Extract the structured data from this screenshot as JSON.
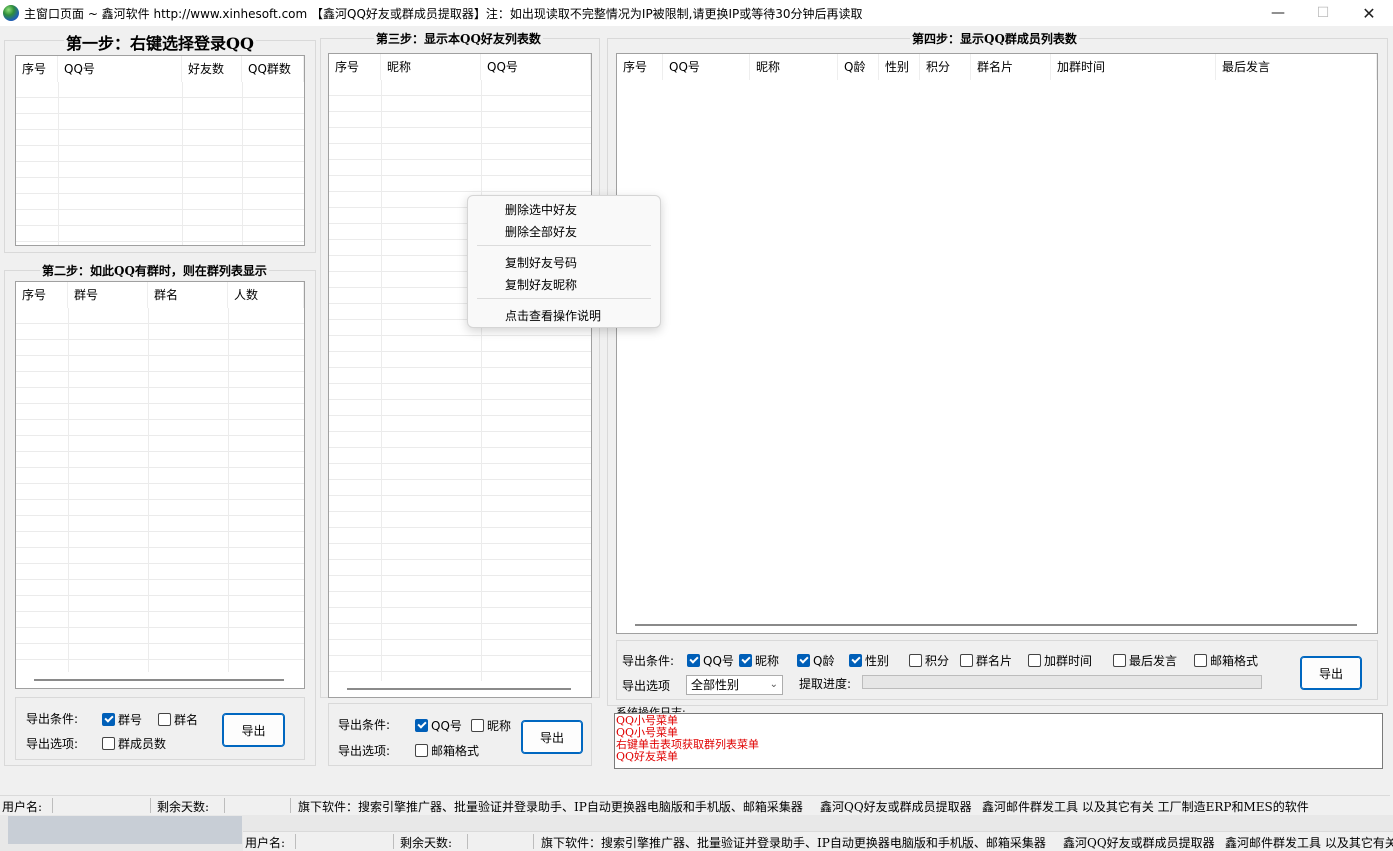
{
  "window": {
    "title": "主窗口页面 ~ 鑫河软件 http://www.xinhesoft.com 【鑫河QQ好友或群成员提取器】注：如出现读取不完整情况为IP被限制,请更换IP或等待30分钟后再读取",
    "minimize_glyph": "—",
    "maximize_glyph": "☐",
    "close_glyph": "✕"
  },
  "step1": {
    "title": "第一步：右键选择登录QQ",
    "columns": [
      "序号",
      "QQ号",
      "好友数",
      "QQ群数"
    ]
  },
  "step2": {
    "title": "第二步：如此QQ有群时，则在群列表显示",
    "columns": [
      "序号",
      "群号",
      "群名",
      "人数"
    ],
    "export_condition_label": "导出条件:",
    "export_option_label": "导出选项:",
    "checkboxes": [
      {
        "label": "群号",
        "checked": true
      },
      {
        "label": "群名",
        "checked": false
      },
      {
        "label": "群成员数",
        "checked": false
      }
    ],
    "export_button": "导出"
  },
  "step3": {
    "title": "第三步：显示本QQ好友列表数",
    "columns": [
      "序号",
      "昵称",
      "QQ号"
    ],
    "export_condition_label": "导出条件:",
    "export_option_label": "导出选项:",
    "checkboxes": [
      {
        "label": "QQ号",
        "checked": true
      },
      {
        "label": "昵称",
        "checked": false
      },
      {
        "label": "邮箱格式",
        "checked": false
      }
    ],
    "export_button": "导出"
  },
  "step4": {
    "title": "第四步：显示QQ群成员列表数",
    "columns": [
      "序号",
      "QQ号",
      "昵称",
      "Q龄",
      "性别",
      "积分",
      "群名片",
      "加群时间",
      "最后发言"
    ],
    "export_condition_label": "导出条件:",
    "export_option_label": "导出选项",
    "checkboxes": [
      {
        "label": "QQ号",
        "checked": true
      },
      {
        "label": "昵称",
        "checked": true
      },
      {
        "label": "Q龄",
        "checked": true
      },
      {
        "label": "性别",
        "checked": true
      },
      {
        "label": "积分",
        "checked": false
      },
      {
        "label": "群名片",
        "checked": false
      },
      {
        "label": "加群时间",
        "checked": false
      },
      {
        "label": "最后发言",
        "checked": false
      },
      {
        "label": "邮箱格式",
        "checked": false
      }
    ],
    "gender_select": "全部性别",
    "progress_label": "提取进度:",
    "progress_value": 0,
    "export_button": "导出"
  },
  "log": {
    "title": "系统操作日志:",
    "lines": [
      "QQ小号菜单",
      "QQ小号菜单",
      "右键单击表项获取群列表菜单",
      "QQ好友菜单"
    ],
    "color": "#e00000"
  },
  "context_menu": {
    "items": [
      "删除选中好友",
      "删除全部好友",
      "复制好友号码",
      "复制好友昵称",
      "点击查看操作说明"
    ]
  },
  "statusbar": {
    "user_label": "用户名:",
    "days_label": "剩余天数:",
    "products": "旗下软件：搜索引擎推广器、批量验证并登录助手、IP自动更换器电脑版和手机版、邮箱采集器",
    "product2": "鑫河QQ好友或群成员提取器",
    "product3": "鑫河邮件群发工具  以及其它有关 工厂制造ERP和MES的软件"
  },
  "statusbar2": {
    "product3": "鑫河邮件群发工具  以及其它有关"
  }
}
